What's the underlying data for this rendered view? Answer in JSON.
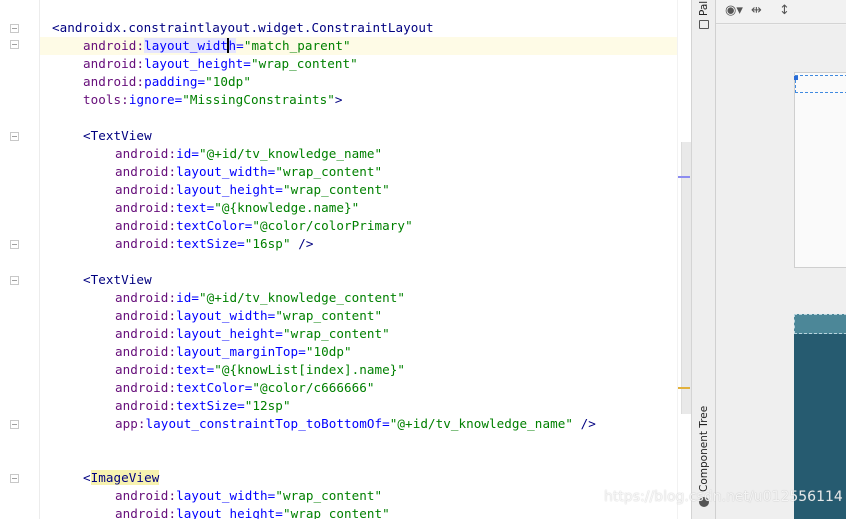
{
  "editor": {
    "lines": [
      {
        "text": "<androidx.constraintlayout.widget.ConstraintLayout",
        "indent": 1,
        "kind": "tag"
      },
      {
        "ns": "android",
        "attr": "layout_width",
        "value": "\"match_parent\"",
        "indent": 2,
        "kind": "attr",
        "current": true
      },
      {
        "ns": "android",
        "attr": "layout_height",
        "value": "\"wrap_content\"",
        "indent": 2,
        "kind": "attr"
      },
      {
        "ns": "android",
        "attr": "padding",
        "value": "\"10dp\"",
        "indent": 2,
        "kind": "attr"
      },
      {
        "ns": "tools",
        "attr": "ignore",
        "value": "\"MissingConstraints\"",
        "close": ">",
        "indent": 2,
        "kind": "attr"
      },
      {
        "text": "",
        "kind": "blank"
      },
      {
        "text": "<TextView",
        "indent": 2,
        "kind": "tag"
      },
      {
        "ns": "android",
        "attr": "id",
        "value": "\"@+id/tv_knowledge_name\"",
        "indent": 3,
        "kind": "attr"
      },
      {
        "ns": "android",
        "attr": "layout_width",
        "value": "\"wrap_content\"",
        "indent": 3,
        "kind": "attr"
      },
      {
        "ns": "android",
        "attr": "layout_height",
        "value": "\"wrap_content\"",
        "indent": 3,
        "kind": "attr"
      },
      {
        "ns": "android",
        "attr": "text",
        "value": "\"@{knowledge.name}\"",
        "indent": 3,
        "kind": "attr"
      },
      {
        "ns": "android",
        "attr": "textColor",
        "value": "\"@color/colorPrimary\"",
        "indent": 3,
        "kind": "attr"
      },
      {
        "ns": "android",
        "attr": "textSize",
        "value": "\"16sp\"",
        "close": " />",
        "indent": 3,
        "kind": "attr"
      },
      {
        "text": "",
        "kind": "blank"
      },
      {
        "text": "<TextView",
        "indent": 2,
        "kind": "tag"
      },
      {
        "ns": "android",
        "attr": "id",
        "value": "\"@+id/tv_knowledge_content\"",
        "indent": 3,
        "kind": "attr"
      },
      {
        "ns": "android",
        "attr": "layout_width",
        "value": "\"wrap_content\"",
        "indent": 3,
        "kind": "attr"
      },
      {
        "ns": "android",
        "attr": "layout_height",
        "value": "\"wrap_content\"",
        "indent": 3,
        "kind": "attr"
      },
      {
        "ns": "android",
        "attr": "layout_marginTop",
        "value": "\"10dp\"",
        "indent": 3,
        "kind": "attr"
      },
      {
        "ns": "android",
        "attr": "text",
        "value": "\"@{knowList[index].name}\"",
        "indent": 3,
        "kind": "attr"
      },
      {
        "ns": "android",
        "attr": "textColor",
        "value": "\"@color/c666666\"",
        "indent": 3,
        "kind": "attr"
      },
      {
        "ns": "android",
        "attr": "textSize",
        "value": "\"12sp\"",
        "indent": 3,
        "kind": "attr"
      },
      {
        "ns": "app",
        "attr": "layout_constraintTop_toBottomOf",
        "value": "\"@+id/tv_knowledge_name\"",
        "close": " />",
        "indent": 3,
        "kind": "attr"
      },
      {
        "text": "",
        "kind": "blank"
      },
      {
        "text": "",
        "kind": "blank"
      },
      {
        "text": "<ImageView",
        "indent": 2,
        "kind": "tag",
        "highlight_tag": true
      },
      {
        "ns": "android",
        "attr": "layout_width",
        "value": "\"wrap_content\"",
        "indent": 3,
        "kind": "attr"
      },
      {
        "ns": "android",
        "attr": "layout_height",
        "value": "\"wrap_content\"",
        "indent": 3,
        "kind": "attr"
      }
    ]
  },
  "side_panel": {
    "palette_tab": "Pal",
    "component_tree_tab": "Component Tree",
    "toolbar_icons": [
      "eye-icon",
      "horizontal-constraints-icon",
      "vertical-constraints-icon"
    ]
  },
  "watermark": "https://blog.csdn.net/u012556114",
  "colors": {
    "tag": "#000080",
    "namespace": "#660e7a",
    "attribute": "#0000ff",
    "value": "#008000",
    "current_line": "#fefbe6",
    "preview_dark": "#265b70"
  }
}
